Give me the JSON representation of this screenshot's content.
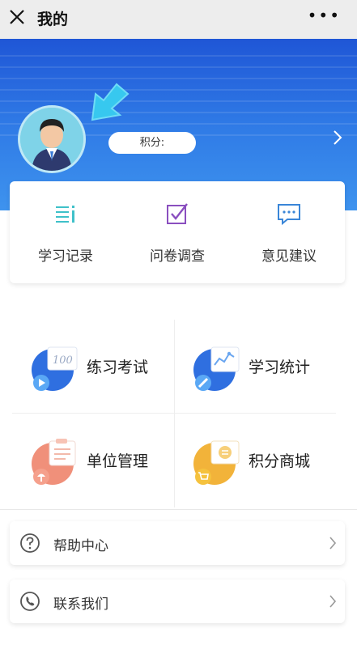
{
  "header": {
    "title": "我的",
    "close_icon": "close-icon",
    "more_icon": "more-icon"
  },
  "profile": {
    "points_label": "积分:",
    "colors": {
      "hero_top": "#1f56d6",
      "hero_bottom": "#3e93ee"
    }
  },
  "quick_actions": [
    {
      "label": "学习记录",
      "icon": "list-icon",
      "color": "#3fc1c9"
    },
    {
      "label": "问卷调查",
      "icon": "checkbox-icon",
      "color": "#8a4fbf"
    },
    {
      "label": "意见建议",
      "icon": "chat-bubble-icon",
      "color": "#3a86d8"
    }
  ],
  "modules": [
    {
      "label": "练习考试",
      "icon": "practice-exam-icon"
    },
    {
      "label": "学习统计",
      "icon": "study-stats-icon"
    },
    {
      "label": "单位管理",
      "icon": "unit-management-icon"
    },
    {
      "label": "积分商城",
      "icon": "points-mall-icon"
    }
  ],
  "list": [
    {
      "label": "帮助中心",
      "icon": "help-icon"
    },
    {
      "label": "联系我们",
      "icon": "phone-icon"
    }
  ]
}
